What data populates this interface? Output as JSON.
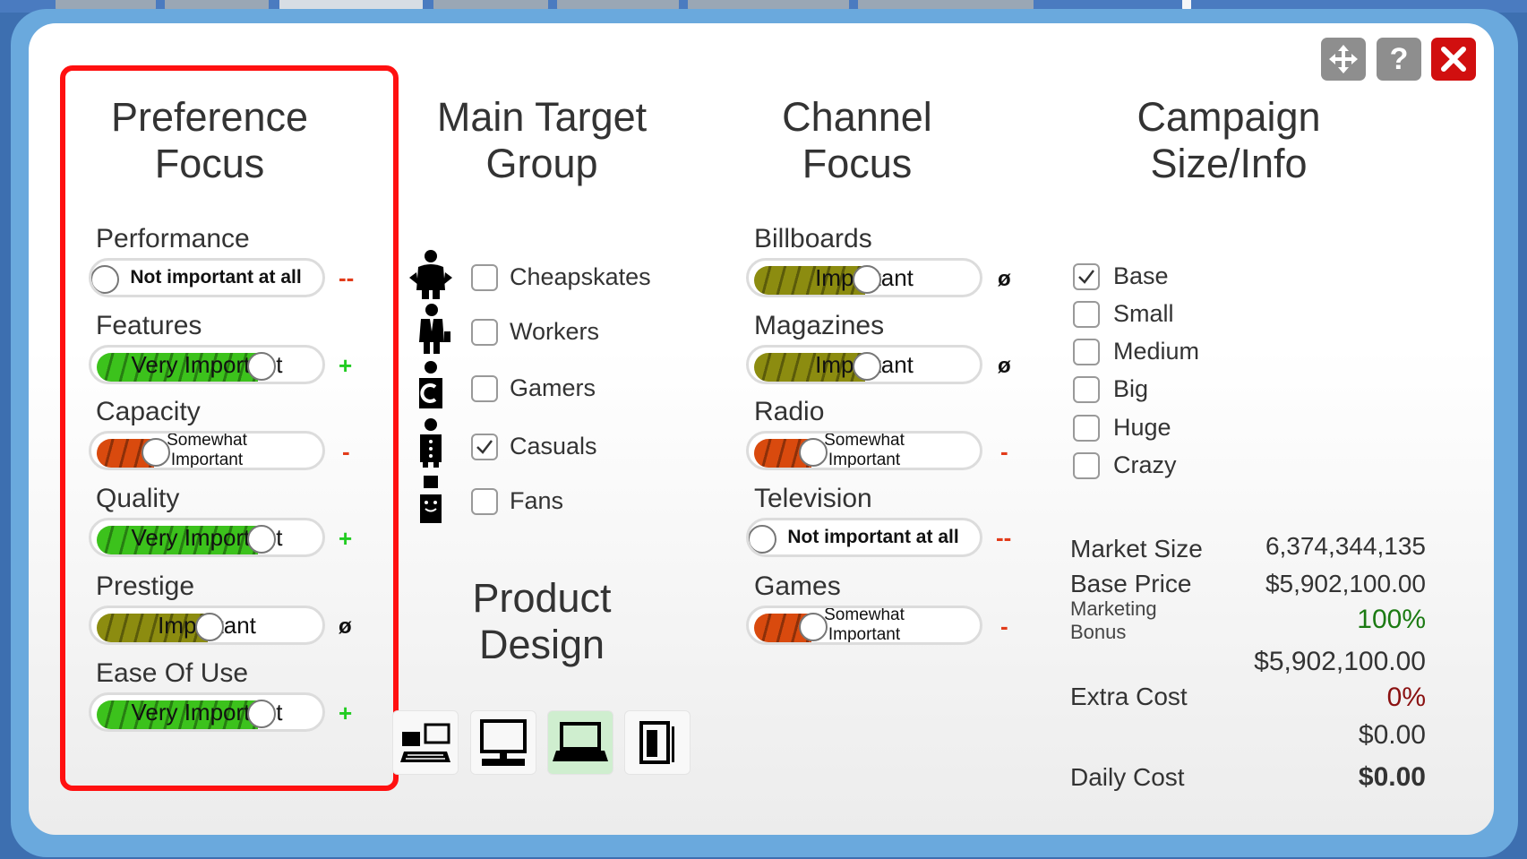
{
  "titlebar": {
    "move_icon": "move-arrows-icon",
    "help_icon": "question-icon",
    "close_icon": "close-x-icon"
  },
  "preference": {
    "title": "Preference\nFocus",
    "items": [
      {
        "label": "Performance",
        "value": "Not important at all",
        "level": 0.0,
        "indicator": "--"
      },
      {
        "label": "Features",
        "value": "Very Important",
        "level": 0.75,
        "indicator": "+"
      },
      {
        "label": "Capacity",
        "value": "Somewhat\nImportant",
        "level": 0.25,
        "indicator": "-"
      },
      {
        "label": "Quality",
        "value": "Very Important",
        "level": 0.75,
        "indicator": "+"
      },
      {
        "label": "Prestige",
        "value": "Important",
        "level": 0.5,
        "indicator": "ø"
      },
      {
        "label": "Ease Of Use",
        "value": "Very Important",
        "level": 0.75,
        "indicator": "+"
      }
    ]
  },
  "target": {
    "title": "Main Target\nGroup",
    "groups": [
      {
        "label": "Cheapskates",
        "checked": false,
        "icon": "cheapskate-person-icon"
      },
      {
        "label": "Workers",
        "checked": false,
        "icon": "worker-person-icon"
      },
      {
        "label": "Gamers",
        "checked": false,
        "icon": "gamer-person-icon"
      },
      {
        "label": "Casuals",
        "checked": true,
        "icon": "casual-person-icon"
      },
      {
        "label": "Fans",
        "checked": false,
        "icon": "fan-person-icon"
      }
    ]
  },
  "product": {
    "title": "Product\nDesign",
    "devices": [
      {
        "icon": "workstation-icon",
        "selected": false
      },
      {
        "icon": "desktop-pc-icon",
        "selected": false
      },
      {
        "icon": "laptop-icon",
        "selected": true
      },
      {
        "icon": "tablet-icon",
        "selected": false
      }
    ]
  },
  "channel": {
    "title": "Channel\nFocus",
    "items": [
      {
        "label": "Billboards",
        "value": "Important",
        "level": 0.5,
        "indicator": "ø"
      },
      {
        "label": "Magazines",
        "value": "Important",
        "level": 0.5,
        "indicator": "ø"
      },
      {
        "label": "Radio",
        "value": "Somewhat\nImportant",
        "level": 0.25,
        "indicator": "-"
      },
      {
        "label": "Television",
        "value": "Not important at all",
        "level": 0.0,
        "indicator": "--"
      },
      {
        "label": "Games",
        "value": "Somewhat\nImportant",
        "level": 0.25,
        "indicator": "-"
      }
    ]
  },
  "campaign": {
    "title": "Campaign\nSize/Info",
    "sizes": [
      {
        "label": "Base",
        "checked": true
      },
      {
        "label": "Small",
        "checked": false
      },
      {
        "label": "Medium",
        "checked": false
      },
      {
        "label": "Big",
        "checked": false
      },
      {
        "label": "Huge",
        "checked": false
      },
      {
        "label": "Crazy",
        "checked": false
      }
    ],
    "market_size_label": "Market Size",
    "market_size": "6,374,344,135",
    "base_price_label": "Base Price",
    "base_price": "$5,902,100.00",
    "marketing_bonus_label": "Marketing\nBonus",
    "marketing_bonus": "100%",
    "bonus_total": "$5,902,100.00",
    "extra_cost_label": "Extra Cost",
    "extra_cost": "0%",
    "extra_cost_value": "$0.00",
    "daily_cost_label": "Daily Cost",
    "daily_cost": "$0.00"
  },
  "colors": {
    "highlight": "#ff1010",
    "green": "#3cc21c",
    "olive": "#8c8c10",
    "orange": "#d94a0e",
    "bonus": "#1b7a12",
    "extra": "#8a1010"
  }
}
